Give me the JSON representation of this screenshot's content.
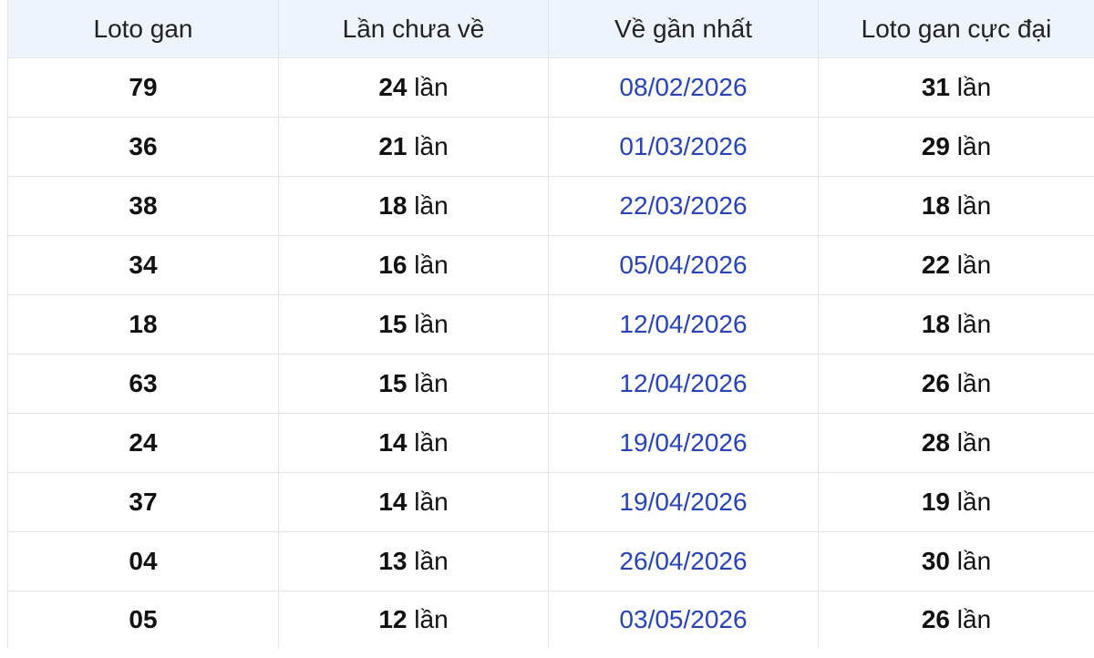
{
  "table": {
    "headers": [
      "Loto gan",
      "Lần chưa về",
      "Về gần nhất",
      "Loto gan cực đại"
    ],
    "unit": "lần",
    "rows": [
      {
        "loto": "79",
        "chua_ve": "24",
        "ve_gan_nhat": "08/02/2026",
        "cuc_dai": "31"
      },
      {
        "loto": "36",
        "chua_ve": "21",
        "ve_gan_nhat": "01/03/2026",
        "cuc_dai": "29"
      },
      {
        "loto": "38",
        "chua_ve": "18",
        "ve_gan_nhat": "22/03/2026",
        "cuc_dai": "18"
      },
      {
        "loto": "34",
        "chua_ve": "16",
        "ve_gan_nhat": "05/04/2026",
        "cuc_dai": "22"
      },
      {
        "loto": "18",
        "chua_ve": "15",
        "ve_gan_nhat": "12/04/2026",
        "cuc_dai": "18"
      },
      {
        "loto": "63",
        "chua_ve": "15",
        "ve_gan_nhat": "12/04/2026",
        "cuc_dai": "26"
      },
      {
        "loto": "24",
        "chua_ve": "14",
        "ve_gan_nhat": "19/04/2026",
        "cuc_dai": "28"
      },
      {
        "loto": "37",
        "chua_ve": "14",
        "ve_gan_nhat": "19/04/2026",
        "cuc_dai": "19"
      },
      {
        "loto": "04",
        "chua_ve": "13",
        "ve_gan_nhat": "26/04/2026",
        "cuc_dai": "30"
      },
      {
        "loto": "05",
        "chua_ve": "12",
        "ve_gan_nhat": "03/05/2026",
        "cuc_dai": "26"
      }
    ]
  },
  "colors": {
    "header_bg": "#eef4fc",
    "date_link": "#2744b6",
    "border": "#e2e4ea"
  }
}
